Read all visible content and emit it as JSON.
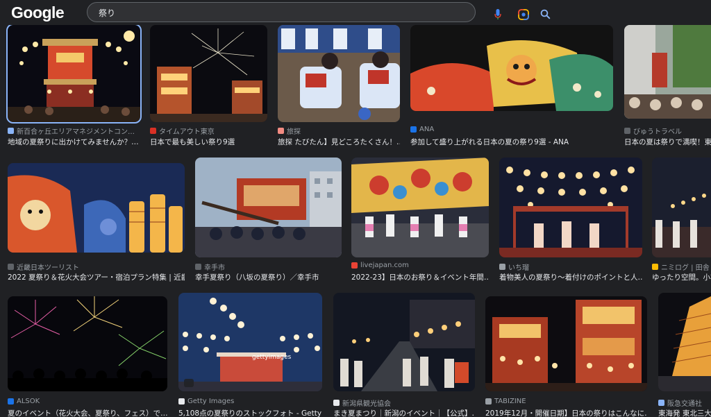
{
  "header": {
    "logo": "Google",
    "query": "祭り"
  },
  "results": [
    {
      "source": "新百合ヶ丘エリアマネジメントコン…",
      "title": "地域の夏祭りに出かけてみませんか？…",
      "fav": "#8ab4f8"
    },
    {
      "source": "タイムアウト東京",
      "title": "日本で最も美しい祭り9選",
      "fav": "#d93025"
    },
    {
      "source": "旅探",
      "title": "旅探 たびたん】見どころたくさん！…",
      "fav": "#f28b82"
    },
    {
      "source": "ANA",
      "title": "参加して盛り上がれる日本の夏の祭り9選 - ANA",
      "fav": "#1a73e8"
    },
    {
      "source": "びゅうトラベル",
      "title": "日本の夏は祭りで満喫！東日…",
      "fav": "#5f6368"
    },
    {
      "source": "近畿日本ツーリスト",
      "title": "2022 夏祭り＆花火大会ツアー・宿泊プラン特集 | 近畿…",
      "fav": "#5f6368"
    },
    {
      "source": "幸手市",
      "title": "幸手夏祭り（八坂の夏祭り）／幸手市",
      "fav": "#5f6368"
    },
    {
      "source": "livejapan.com",
      "title": "2022-23】日本のお祭り＆イベント年間…",
      "fav": "#ea4335"
    },
    {
      "source": "いち瑠",
      "title": "着物美人の夏祭り〜着付けのポイントと人…",
      "fav": "#9aa0a6"
    },
    {
      "source": "ニミログ | 田舎",
      "title": "ゆったり空間。小将…",
      "fav": "#fbbc04"
    },
    {
      "source": "ALSOK",
      "title": "夏のイベント（花火大会、夏祭り、フェス）で…",
      "fav": "#1a73e8"
    },
    {
      "source": "Getty Images",
      "title": "5,108点の夏祭りのストックフォト - Getty I…",
      "fav": "#e8eaed"
    },
    {
      "source": "新潟県観光協会",
      "title": "まき夏まつり｜新潟のイベント｜【公式】…",
      "fav": "#e8eaed"
    },
    {
      "source": "TABIZINE",
      "title": "2019年12月・開催日期】日本の祭りはこんなに…",
      "fav": "#9aa0a6"
    },
    {
      "source": "阪急交通社",
      "title": "東海発 東北三大…",
      "fav": "#8ab4f8"
    }
  ],
  "watermark": "gettyimages"
}
